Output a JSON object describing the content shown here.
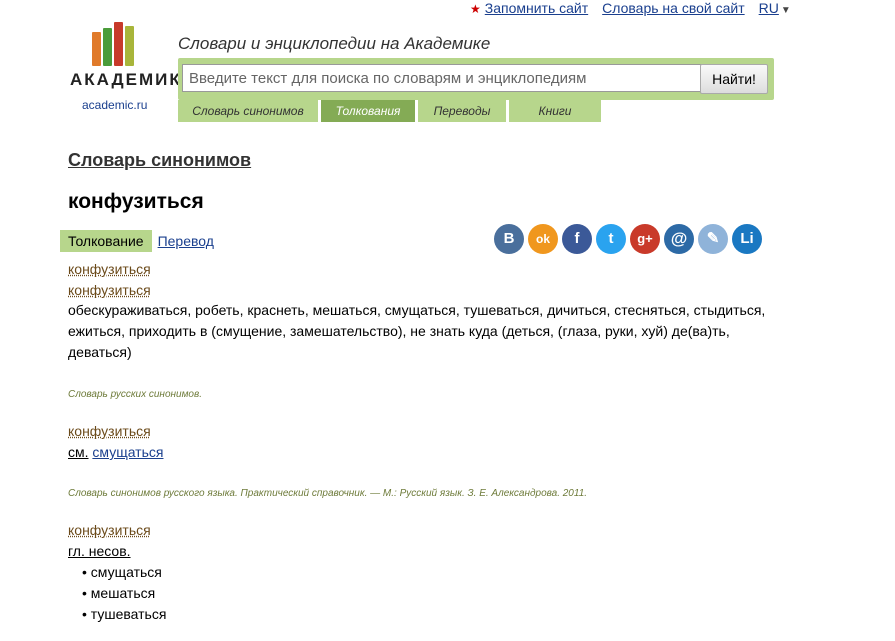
{
  "toplinks": {
    "remember": "Запомнить сайт",
    "dictionary": "Словарь на свой сайт",
    "lang": "RU"
  },
  "logo": {
    "title": "АКАДЕМИК",
    "site": "academic.ru"
  },
  "tagline": "Словари и энциклопедии на Академике",
  "search": {
    "placeholder": "Введите текст для поиска по словарям и энциклопедиям",
    "button": "Найти!"
  },
  "tabs": [
    "Словарь синонимов",
    "Толкования",
    "Переводы",
    "Книги"
  ],
  "dictionary_title": "Словарь синонимов",
  "headword": "конфузиться",
  "subtabs": {
    "active": "Толкование",
    "link": "Перевод"
  },
  "social": [
    "В",
    "ok",
    "f",
    "t",
    "g+",
    "@",
    "✎",
    "Li"
  ],
  "colors": {
    "green": "#b7d68c",
    "green_active": "#84ab55",
    "link": "#1a3f8e",
    "word": "#6b4a1a"
  },
  "entry1": {
    "w1": "конфузиться",
    "w2": "конфузиться",
    "line1": "обескураживаться, робеть, краснеть, мешаться, смущаться, тушеваться, дичиться, стесняться, стыдиться,",
    "line2": "ежиться, приходить в (смущение, замешательство), не знать куда (деться, (глаза, руки, хуй) де(ва)ть,",
    "line3": "деваться)",
    "source": "Словарь русских синонимов."
  },
  "entry2": {
    "w": "конфузиться",
    "see": "см.",
    "link": "смущаться",
    "source": "Словарь синонимов русского языка. Практический справочник. — М.: Русский язык. З. Е. Александрова. 2011."
  },
  "entry3": {
    "w": "конфузиться",
    "pos": "гл. несов.",
    "items": [
      "смущаться",
      "мешаться",
      "тушеваться"
    ]
  }
}
